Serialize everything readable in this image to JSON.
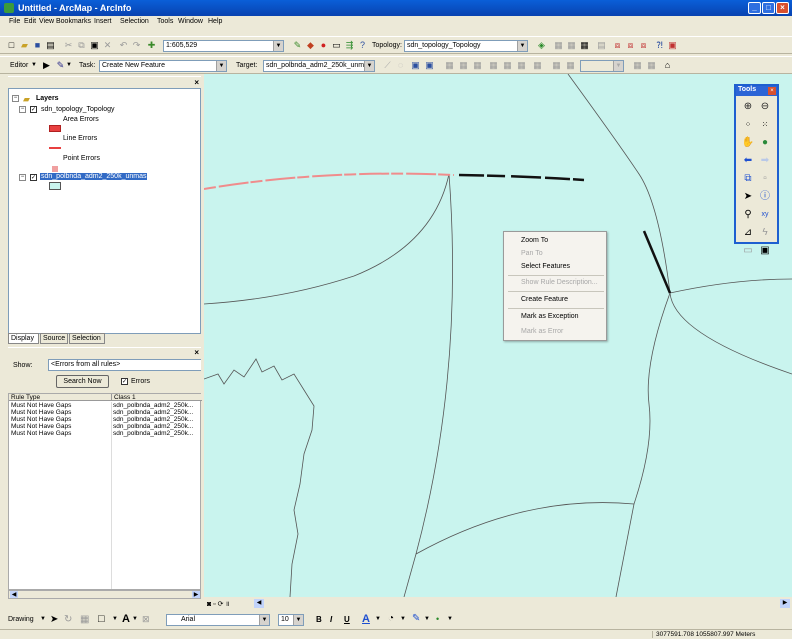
{
  "window": {
    "title": "Untitled - ArcMap - ArcInfo"
  },
  "menu": [
    "File",
    "Edit",
    "View",
    "Bookmarks",
    "Insert",
    "Selection",
    "Tools",
    "Window",
    "Help"
  ],
  "standard_toolbar": {
    "scale": "1:605,529",
    "topology_label": "Topology:",
    "topology_value": "sdn_topology_Topology"
  },
  "editor_toolbar": {
    "editor_label": "Editor",
    "task_label": "Task:",
    "task_value": "Create New Feature",
    "target_label": "Target:",
    "target_value": "sdn_polbnda_adm2_250k_unma"
  },
  "toc": {
    "root": "Layers",
    "topology_layer": "sdn_topology_Topology",
    "area_errors": "Area Errors",
    "line_errors": "Line Errors",
    "point_errors": "Point Errors",
    "polygon_layer": "sdn_polbnda_adm2_250k_unmas"
  },
  "toc_tabs": [
    "Display",
    "Source",
    "Selection"
  ],
  "error_inspector": {
    "show_label": "Show:",
    "show_value": "<Errors from all rules>",
    "search_button": "Search Now",
    "errors_checkbox": "Errors",
    "columns": [
      "Rule Type",
      "Class 1"
    ],
    "rows": [
      [
        "Must Not Have Gaps",
        "sdn_polbnda_adm2_250k..."
      ],
      [
        "Must Not Have Gaps",
        "sdn_polbnda_adm2_250k..."
      ],
      [
        "Must Not Have Gaps",
        "sdn_polbnda_adm2_250k..."
      ],
      [
        "Must Not Have Gaps",
        "sdn_polbnda_adm2_250k..."
      ],
      [
        "Must Not Have Gaps",
        "sdn_polbnda_adm2_250k..."
      ]
    ]
  },
  "context_menu": {
    "items": [
      {
        "label": "Zoom To",
        "enabled": true
      },
      {
        "label": "Pan To",
        "enabled": false
      },
      {
        "label": "Select Features",
        "enabled": true
      },
      {
        "label": "Show Rule Description...",
        "enabled": false
      },
      {
        "label": "Create Feature",
        "enabled": true
      },
      {
        "label": "Mark as Exception",
        "enabled": true
      },
      {
        "label": "Mark as Error",
        "enabled": false
      }
    ]
  },
  "tools_palette": {
    "title": "Tools"
  },
  "drawing_toolbar": {
    "drawing_label": "Drawing",
    "font": "Arial",
    "font_size": "10"
  },
  "status": {
    "coordinates": "3077591.708  1055807.997 Meters"
  },
  "colors": {
    "map_background": "#c9f4ee",
    "error_line": "#f08c8c",
    "selected_line": "#111111",
    "title_bar": "#0a5fd8"
  }
}
